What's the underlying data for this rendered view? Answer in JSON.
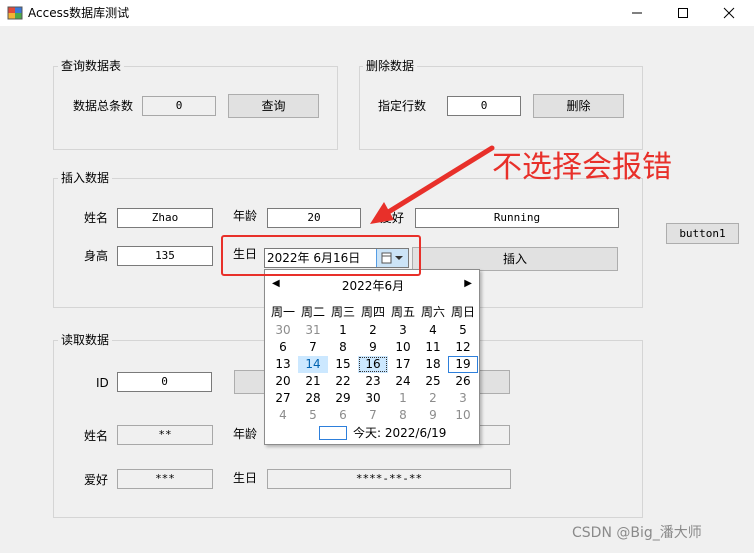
{
  "window": {
    "title": "Access数据库测试",
    "controls": {
      "minimize": "minimize-icon",
      "maximize": "maximize-icon",
      "close": "close-icon"
    }
  },
  "query_group": {
    "title": "查询数据表",
    "count_label": "数据总条数",
    "count_value": "0",
    "query_button": "查询"
  },
  "delete_group": {
    "title": "删除数据",
    "row_label": "指定行数",
    "row_value": "0",
    "delete_button": "删除"
  },
  "insert_group": {
    "title": "插入数据",
    "name_label": "姓名",
    "name_value": "Zhao",
    "age_label": "年龄",
    "age_value": "20",
    "hobby_label": "爱好",
    "hobby_value": "Running",
    "height_label": "身高",
    "height_value": "135",
    "birthday_label": "生日",
    "birthday_value": "2022年  6月16日",
    "insert_button": "插入"
  },
  "side_button": "button1",
  "read_group": {
    "title": "读取数据",
    "id_label": "ID",
    "id_value": "0",
    "name_label": "姓名",
    "name_value": "**",
    "age_label": "年龄",
    "hobby_label": "爱好",
    "hobby_value": "***",
    "birthday_label": "生日",
    "birthday_value": "****-**-**"
  },
  "calendar": {
    "month_title": "2022年6月",
    "weekdays": [
      "周一",
      "周二",
      "周三",
      "周四",
      "周五",
      "周六",
      "周日"
    ],
    "weeks": [
      [
        "30",
        "31",
        "1",
        "2",
        "3",
        "4",
        "5"
      ],
      [
        "6",
        "7",
        "8",
        "9",
        "10",
        "11",
        "12"
      ],
      [
        "13",
        "14",
        "15",
        "16",
        "17",
        "18",
        "19"
      ],
      [
        "20",
        "21",
        "22",
        "23",
        "24",
        "25",
        "26"
      ],
      [
        "27",
        "28",
        "29",
        "30",
        "1",
        "2",
        "3"
      ],
      [
        "4",
        "5",
        "6",
        "7",
        "8",
        "9",
        "10"
      ]
    ],
    "today_label": "今天: 2022/6/19"
  },
  "annotation": {
    "text": "不选择会报错",
    "color": "#e8302a"
  },
  "watermark": "CSDN @Big_潘大师",
  "colors": {
    "accent": "#2d7fdb",
    "highlight": "#cce8ff",
    "annotation": "#e8302a"
  }
}
